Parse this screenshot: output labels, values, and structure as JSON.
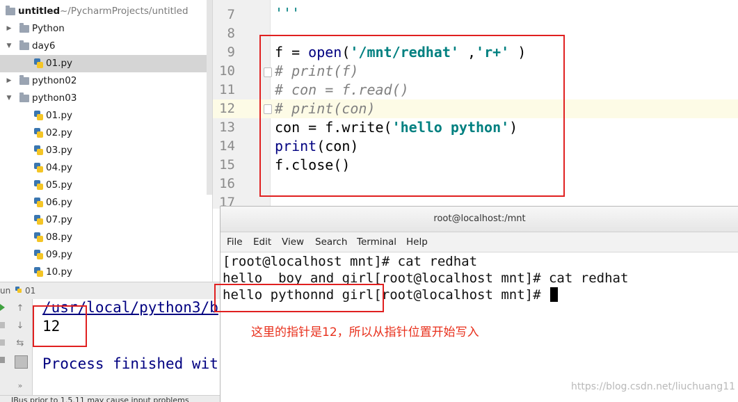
{
  "project": {
    "root_name": "untitled",
    "root_path": "~/PycharmProjects/untitled",
    "items": [
      {
        "label": "Python",
        "kind": "folder",
        "expanded": false
      },
      {
        "label": "day6",
        "kind": "folder",
        "expanded": true
      },
      {
        "label": "01.py",
        "kind": "file",
        "selected": true
      },
      {
        "label": "python02",
        "kind": "folder",
        "expanded": false
      },
      {
        "label": "python03",
        "kind": "folder",
        "expanded": true
      },
      {
        "label": "01.py",
        "kind": "file"
      },
      {
        "label": "02.py",
        "kind": "file"
      },
      {
        "label": "03.py",
        "kind": "file"
      },
      {
        "label": "04.py",
        "kind": "file"
      },
      {
        "label": "05.py",
        "kind": "file"
      },
      {
        "label": "06.py",
        "kind": "file"
      },
      {
        "label": "07.py",
        "kind": "file"
      },
      {
        "label": "08.py",
        "kind": "file"
      },
      {
        "label": "09.py",
        "kind": "file"
      },
      {
        "label": "10.py",
        "kind": "file"
      }
    ]
  },
  "editor": {
    "line_numbers": [
      "7",
      "8",
      "9",
      "10",
      "11",
      "12",
      "13",
      "14",
      "15",
      "16",
      "17"
    ],
    "line7_text": "'''",
    "line9": {
      "a": "f = ",
      "b": "open",
      "c": "(",
      "d": "'/mnt/redhat'",
      "e": " ,",
      "f": "'r+'",
      "g": " )"
    },
    "line10": "# print(f)",
    "line11": "# con = f.read()",
    "line12": "# print(con)",
    "line13": {
      "a": "con = f.write(",
      "b": "'hello python'",
      "c": ")"
    },
    "line14": {
      "a": "print",
      "b": "(con)"
    },
    "line15": "f.close()"
  },
  "run": {
    "tab_prefix": "un",
    "tab_label": "01",
    "path_text": "/usr/local/python3/b",
    "result": "12",
    "finished": "Process finished wit",
    "status": "IBus prior to 1.5.11 may cause input problems"
  },
  "terminal": {
    "title": "root@localhost:/mnt",
    "menu": [
      "File",
      "Edit",
      "View",
      "Search",
      "Terminal",
      "Help"
    ],
    "lines": [
      "[root@localhost mnt]# cat redhat",
      "hello  boy and girl[root@localhost mnt]# cat redhat",
      "hello pythonnd girl[root@localhost mnt]# "
    ],
    "note": "这里的指针是12，所以从指针位置开始写入",
    "watermark": "https://blog.csdn.net/liuchuang11"
  },
  "colors": {
    "annotation_red": "#e02020",
    "keyword": "#000080",
    "string": "#008080",
    "comment": "#808080"
  }
}
